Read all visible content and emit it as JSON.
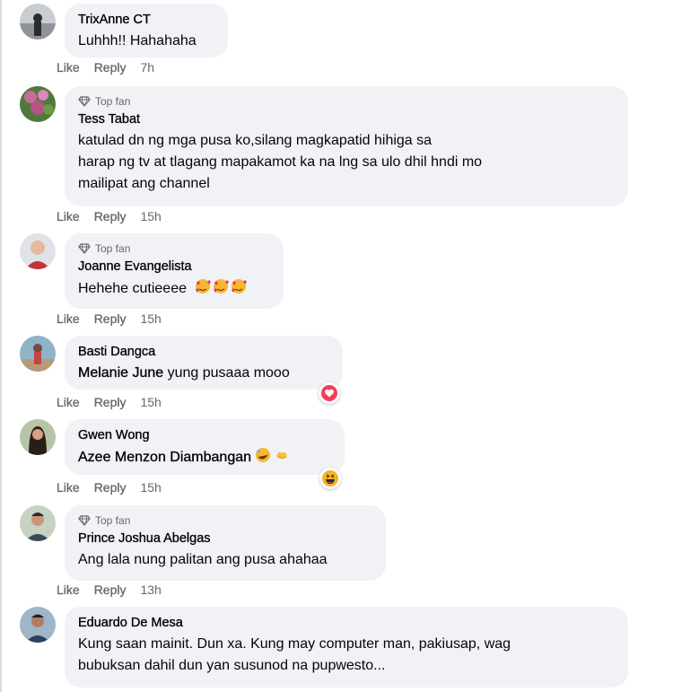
{
  "comments": [
    {
      "top_fan": false,
      "author": "TrixAnne CT",
      "text": "Luhhh!! Hahahaha",
      "time": "7h"
    },
    {
      "top_fan": true,
      "badge": "Top fan",
      "author": "Tess Tabat",
      "lines": [
        "katulad dn ng mga pusa ko,silang magkapatid hihiga sa",
        "harap ng tv at tlagang mapakamot ka na lng sa ulo dhil hndi mo",
        "mailipat ang channel"
      ],
      "time": "15h"
    },
    {
      "top_fan": true,
      "badge": "Top fan",
      "author": "Joanne Evangelista",
      "text": "Hehehe cutieeee",
      "time": "15h"
    },
    {
      "top_fan": false,
      "author": "Basti Dangca",
      "mention": "Melanie June",
      "text": " yung pusaaa mooo",
      "time": "15h",
      "reaction": "heart-reaction"
    },
    {
      "top_fan": false,
      "author": "Gwen Wong",
      "mention": "Azee Menzon Diambangan",
      "time": "15h",
      "reaction": "haha-reaction"
    },
    {
      "top_fan": true,
      "badge": "Top fan",
      "author": "Prince Joshua Abelgas",
      "text": "Ang lala nung palitan ang pusa ahahaa",
      "time": "13h"
    },
    {
      "top_fan": false,
      "author": "Eduardo De Mesa",
      "lines": [
        "Kung saan mainit. Dun xa. Kung may computer man, pakiusap, wag",
        "bubuksan dahil dun yan susunod na pupwesto..."
      ]
    }
  ],
  "actions": {
    "like": "Like",
    "reply": "Reply"
  },
  "colors": {
    "bubble": "#f0f2f5",
    "meta": "#65676b",
    "text": "#050505"
  }
}
